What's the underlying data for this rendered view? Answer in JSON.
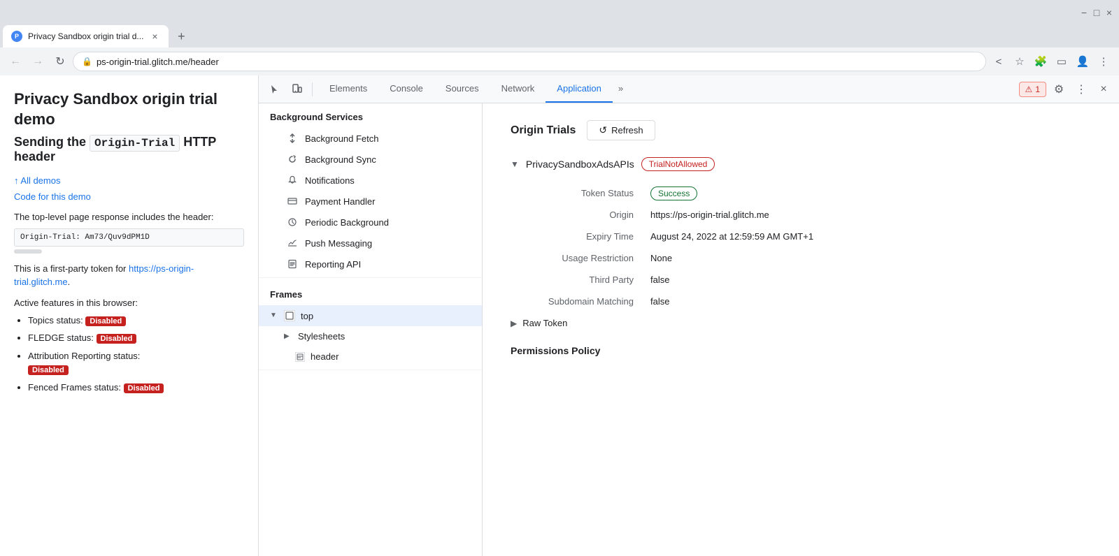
{
  "browser": {
    "tab": {
      "title": "Privacy Sandbox origin trial d...",
      "favicon_label": "PS",
      "close_label": "×"
    },
    "new_tab_label": "+",
    "nav": {
      "back_label": "←",
      "forward_label": "→",
      "refresh_label": "↻",
      "url": "ps-origin-trial.glitch.me/header",
      "lock_icon": "🔒"
    },
    "address_actions": {
      "share_label": "<",
      "star_label": "☆",
      "extension_label": "🧩",
      "sidebar_label": "▭",
      "profile_label": "👤",
      "menu_label": "⋮"
    }
  },
  "page": {
    "title": "Privacy Sandbox origin trial demo",
    "subtitle_pre": "Sending the ",
    "subtitle_code": "Origin-Trial",
    "subtitle_post": " HTTP header",
    "all_demos_link": "↑ All demos",
    "code_link": "Code for this demo",
    "desc1": "The top-level page response includes the header:",
    "header_value": "Origin-Trial: Am73/Quv9dPM1D",
    "desc2_pre": "This is a first-party token for ",
    "desc2_url": "https://ps-origin-trial.glitch.me",
    "desc2_post": ".",
    "features_title": "Active features in this browser:",
    "features": [
      {
        "label": "Topics status: ",
        "status": "Disabled",
        "status_color": "#c5221f"
      },
      {
        "label": "FLEDGE status: ",
        "status": "Disabled",
        "status_color": "#c5221f"
      },
      {
        "label": "Attribution Reporting status: ",
        "status": "Disabled",
        "status_color": "#c5221f"
      },
      {
        "label": "Fenced Frames status: ",
        "status": "Disabled",
        "status_color": "#c5221f"
      }
    ]
  },
  "devtools": {
    "toolbar": {
      "cursor_icon": "↖",
      "device_icon": "📱",
      "tabs": [
        "Elements",
        "Console",
        "Sources",
        "Network",
        "Application"
      ],
      "active_tab": "Application",
      "more_label": "»",
      "warning_label": "⚠",
      "warning_count": "1",
      "settings_label": "⚙",
      "more_menu_label": "⋮",
      "close_label": "×"
    },
    "sidebar": {
      "background_services_title": "Background Services",
      "bg_items": [
        {
          "label": "Background Fetch",
          "icon": "↕"
        },
        {
          "label": "Background Sync",
          "icon": "↺"
        },
        {
          "label": "Notifications",
          "icon": "🔔"
        },
        {
          "label": "Payment Handler",
          "icon": "🪙"
        },
        {
          "label": "Periodic Background",
          "icon": "🕐"
        },
        {
          "label": "Push Messaging",
          "icon": "☁"
        },
        {
          "label": "Reporting API",
          "icon": "📄"
        }
      ],
      "frames_title": "Frames",
      "frames": [
        {
          "label": "top",
          "expanded": true,
          "indent": 0
        },
        {
          "label": "Stylesheets",
          "expanded": false,
          "indent": 1
        },
        {
          "label": "header",
          "indent": 2
        }
      ]
    },
    "main": {
      "header_title": "Origin Trials",
      "refresh_btn_label": "Refresh",
      "trial_name": "PrivacySandboxAdsAPIs",
      "trial_status": "TrialNotAllowed",
      "token_status_label": "Token Status",
      "token_status_value": "Success",
      "origin_label": "Origin",
      "origin_value": "https://ps-origin-trial.glitch.me",
      "expiry_label": "Expiry Time",
      "expiry_value": "August 24, 2022 at 12:59:59 AM GMT+1",
      "usage_label": "Usage Restriction",
      "usage_value": "None",
      "third_party_label": "Third Party",
      "third_party_value": "false",
      "subdomain_label": "Subdomain Matching",
      "subdomain_value": "false",
      "raw_token_label": "Raw Token",
      "permissions_title": "Permissions Policy"
    }
  }
}
